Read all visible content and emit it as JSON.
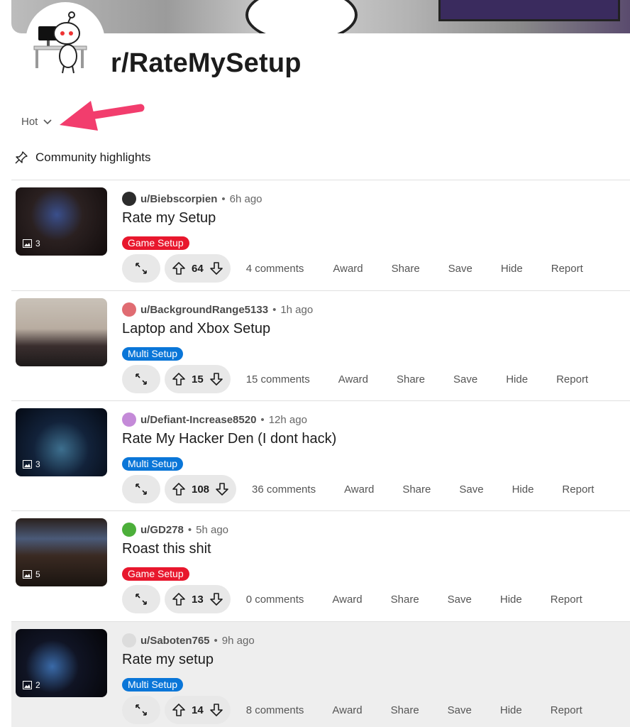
{
  "subreddit": {
    "name": "r/RateMySetup"
  },
  "sort": {
    "label": "Hot"
  },
  "highlights": {
    "label": "Community highlights"
  },
  "labels": {
    "award": "Award",
    "share": "Share",
    "save": "Save",
    "hide": "Hide",
    "report": "Report"
  },
  "posts": [
    {
      "username": "u/Biebscorpien",
      "time": "6h ago",
      "title": "Rate my Setup",
      "flair": "Game Setup",
      "flair_color": "#e8172d",
      "votes": "64",
      "comments": "4 comments",
      "image_count": "3"
    },
    {
      "username": "u/BackgroundRange5133",
      "time": "1h ago",
      "title": "Laptop and Xbox Setup",
      "flair": "Multi Setup",
      "flair_color": "#0a76d8",
      "votes": "15",
      "comments": "15 comments",
      "image_count": ""
    },
    {
      "username": "u/Defiant-Increase8520",
      "time": "12h ago",
      "title": "Rate My Hacker Den (I dont hack)",
      "flair": "Multi Setup",
      "flair_color": "#0a76d8",
      "votes": "108",
      "comments": "36 comments",
      "image_count": "3"
    },
    {
      "username": "u/GD278",
      "time": "5h ago",
      "title": "Roast this shit",
      "flair": "Game Setup",
      "flair_color": "#e8172d",
      "votes": "13",
      "comments": "0 comments",
      "image_count": "5"
    },
    {
      "username": "u/Saboten765",
      "time": "9h ago",
      "title": "Rate my setup",
      "flair": "Multi Setup",
      "flair_color": "#0a76d8",
      "votes": "14",
      "comments": "8 comments",
      "image_count": "2"
    }
  ],
  "colors": {
    "accent_arrow": "#f23d6d",
    "game_flair": "#e8172d",
    "multi_flair": "#0a76d8"
  }
}
